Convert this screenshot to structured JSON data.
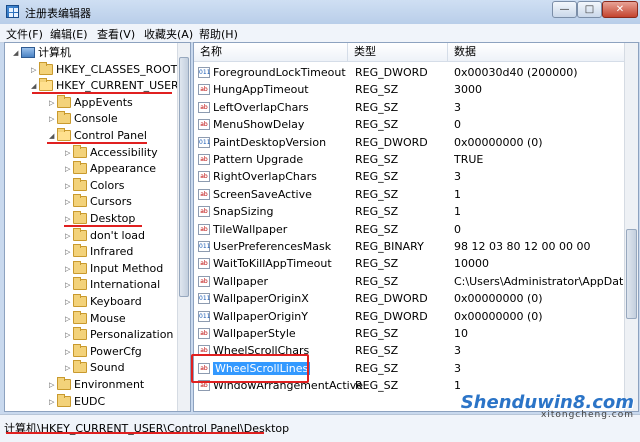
{
  "window": {
    "title": "注册表编辑器"
  },
  "menu": [
    "文件(F)",
    "编辑(E)",
    "查看(V)",
    "收藏夹(A)",
    "帮助(H)"
  ],
  "tree": [
    {
      "label": "计算机",
      "level": 0,
      "expanded": true,
      "icon": "computer-icon"
    },
    {
      "label": "HKEY_CLASSES_ROOT",
      "level": 1,
      "expanded": false,
      "icon": "folder-icon"
    },
    {
      "label": "HKEY_CURRENT_USER",
      "level": 1,
      "expanded": true,
      "icon": "folder-icon"
    },
    {
      "label": "AppEvents",
      "level": 2,
      "expanded": false,
      "icon": "folder-icon"
    },
    {
      "label": "Console",
      "level": 2,
      "expanded": false,
      "icon": "folder-icon"
    },
    {
      "label": "Control Panel",
      "level": 2,
      "expanded": true,
      "icon": "folder-icon"
    },
    {
      "label": "Accessibility",
      "level": 3,
      "expanded": false,
      "icon": "folder-icon"
    },
    {
      "label": "Appearance",
      "level": 3,
      "expanded": false,
      "icon": "folder-icon"
    },
    {
      "label": "Colors",
      "level": 3,
      "expanded": false,
      "icon": "folder-icon"
    },
    {
      "label": "Cursors",
      "level": 3,
      "expanded": false,
      "icon": "folder-icon"
    },
    {
      "label": "Desktop",
      "level": 3,
      "expanded": false,
      "icon": "folder-icon"
    },
    {
      "label": "don't load",
      "level": 3,
      "expanded": false,
      "icon": "folder-icon"
    },
    {
      "label": "Infrared",
      "level": 3,
      "expanded": false,
      "icon": "folder-icon"
    },
    {
      "label": "Input Method",
      "level": 3,
      "expanded": false,
      "icon": "folder-icon"
    },
    {
      "label": "International",
      "level": 3,
      "expanded": false,
      "icon": "folder-icon"
    },
    {
      "label": "Keyboard",
      "level": 3,
      "expanded": false,
      "icon": "folder-icon"
    },
    {
      "label": "Mouse",
      "level": 3,
      "expanded": false,
      "icon": "folder-icon"
    },
    {
      "label": "Personalization",
      "level": 3,
      "expanded": false,
      "icon": "folder-icon"
    },
    {
      "label": "PowerCfg",
      "level": 3,
      "expanded": false,
      "icon": "folder-icon"
    },
    {
      "label": "Sound",
      "level": 3,
      "expanded": false,
      "icon": "folder-icon"
    },
    {
      "label": "Environment",
      "level": 2,
      "expanded": false,
      "icon": "folder-icon"
    },
    {
      "label": "EUDC",
      "level": 2,
      "expanded": false,
      "icon": "folder-icon"
    }
  ],
  "columns": {
    "name": "名称",
    "type": "类型",
    "data": "数据"
  },
  "values": [
    {
      "name": "ForegroundLockTimeout",
      "type": "REG_DWORD",
      "data": "0x00030d40 (200000)",
      "icon": "binary-value-icon"
    },
    {
      "name": "HungAppTimeout",
      "type": "REG_SZ",
      "data": "3000",
      "icon": "string-value-icon"
    },
    {
      "name": "LeftOverlapChars",
      "type": "REG_SZ",
      "data": "3",
      "icon": "string-value-icon"
    },
    {
      "name": "MenuShowDelay",
      "type": "REG_SZ",
      "data": "0",
      "icon": "string-value-icon"
    },
    {
      "name": "PaintDesktopVersion",
      "type": "REG_DWORD",
      "data": "0x00000000 (0)",
      "icon": "binary-value-icon"
    },
    {
      "name": "Pattern Upgrade",
      "type": "REG_SZ",
      "data": "TRUE",
      "icon": "string-value-icon"
    },
    {
      "name": "RightOverlapChars",
      "type": "REG_SZ",
      "data": "3",
      "icon": "string-value-icon"
    },
    {
      "name": "ScreenSaveActive",
      "type": "REG_SZ",
      "data": "1",
      "icon": "string-value-icon"
    },
    {
      "name": "SnapSizing",
      "type": "REG_SZ",
      "data": "1",
      "icon": "string-value-icon"
    },
    {
      "name": "TileWallpaper",
      "type": "REG_SZ",
      "data": "0",
      "icon": "string-value-icon"
    },
    {
      "name": "UserPreferencesMask",
      "type": "REG_BINARY",
      "data": "98 12 03 80 12 00 00 00",
      "icon": "binary-value-icon"
    },
    {
      "name": "WaitToKillAppTimeout",
      "type": "REG_SZ",
      "data": "10000",
      "icon": "string-value-icon"
    },
    {
      "name": "Wallpaper",
      "type": "REG_SZ",
      "data": "C:\\Users\\Administrator\\AppData\\",
      "icon": "string-value-icon"
    },
    {
      "name": "WallpaperOriginX",
      "type": "REG_DWORD",
      "data": "0x00000000 (0)",
      "icon": "binary-value-icon"
    },
    {
      "name": "WallpaperOriginY",
      "type": "REG_DWORD",
      "data": "0x00000000 (0)",
      "icon": "binary-value-icon"
    },
    {
      "name": "WallpaperStyle",
      "type": "REG_SZ",
      "data": "10",
      "icon": "string-value-icon"
    },
    {
      "name": "WheelScrollChars",
      "type": "REG_SZ",
      "data": "3",
      "icon": "string-value-icon"
    },
    {
      "name": "WheelScrollLines",
      "type": "REG_SZ",
      "data": "3",
      "icon": "string-value-icon",
      "selected": true
    },
    {
      "name": "WindowArrangementActive",
      "type": "REG_SZ",
      "data": "1",
      "icon": "string-value-icon"
    }
  ],
  "status": {
    "path": "计算机\\HKEY_CURRENT_USER\\Control Panel\\Desktop"
  },
  "watermark": {
    "line1": "Shenduwin8.com",
    "line2": "xitongcheng.com"
  },
  "colors": {
    "highlight": "#e02020",
    "selection": "#3399ff"
  }
}
